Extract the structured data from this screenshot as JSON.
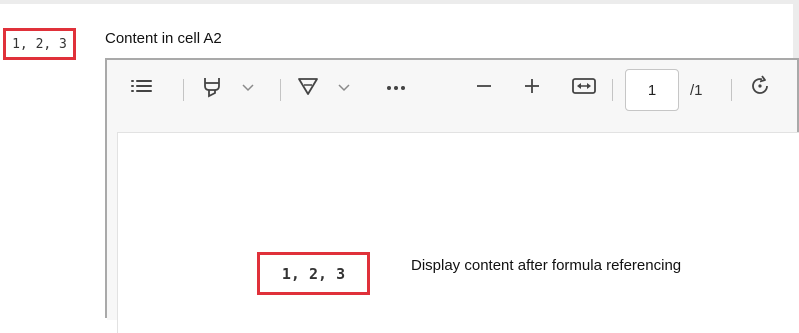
{
  "cell": {
    "a2_value": "1, 2, 3",
    "caption": "Content in cell A2"
  },
  "viewer": {
    "toolbar": {
      "contents_icon": "list-icon",
      "highlight_icon": "highlighter-icon",
      "draw_icon": "pen-icon",
      "more_icon": "more-icon",
      "zoom_out_icon": "minus-icon",
      "zoom_in_icon": "plus-icon",
      "fit_icon": "fit-width-icon",
      "rotate_icon": "rotate-icon",
      "page_current": "1",
      "page_total": "/1"
    },
    "referenced_value": "1, 2, 3"
  },
  "annotation": {
    "caption": "Display content after formula referencing"
  },
  "colors": {
    "highlight_border": "#e0313a",
    "viewer_border": "#a9a9a9",
    "toolbar_bg": "#f7f7f7"
  }
}
